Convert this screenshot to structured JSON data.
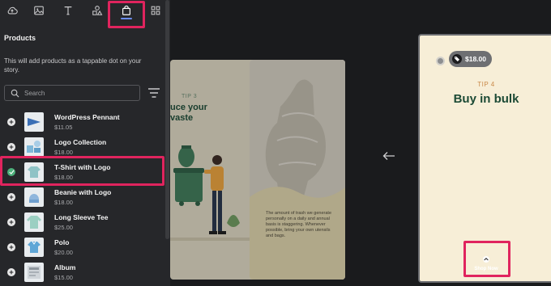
{
  "sidebar": {
    "tabs": [
      {
        "name": "upload"
      },
      {
        "name": "media"
      },
      {
        "name": "text"
      },
      {
        "name": "shapes"
      },
      {
        "name": "shopping"
      },
      {
        "name": "elements"
      }
    ],
    "active_tab": "shopping",
    "title": "Products",
    "description": "This will add products as a tappable dot on your story.",
    "search": {
      "placeholder": "Search",
      "value": ""
    },
    "products": [
      {
        "name": "WordPress Pennant",
        "price": "$11.05",
        "selected": false
      },
      {
        "name": "Logo Collection",
        "price": "$18.00",
        "selected": false
      },
      {
        "name": "T-Shirt with Logo",
        "price": "$18.00",
        "selected": true
      },
      {
        "name": "Beanie with Logo",
        "price": "$18.00",
        "selected": false
      },
      {
        "name": "Long Sleeve Tee",
        "price": "$25.00",
        "selected": false
      },
      {
        "name": "Polo",
        "price": "$20.00",
        "selected": false
      },
      {
        "name": "Album",
        "price": "$15.00",
        "selected": false
      }
    ]
  },
  "canvas": {
    "page1": {
      "tip": "TIP 3",
      "title": "uce your\nvaste"
    },
    "page2": {
      "body": "The amount of trash we generate personally on a daily and annual basis is staggering. Whenever possible, bring your own utensils and bags."
    },
    "page3": {
      "tip": "TIP 4",
      "title": "Buy in bulk",
      "price_tag": "$18.00",
      "shop_now": "Shop Now"
    }
  },
  "colors": {
    "highlight": "#e0245e",
    "accent": "#6b8df5",
    "selected_check": "#4caf7a",
    "story_title": "#1c4a35",
    "tip_label": "#c98a4a"
  }
}
